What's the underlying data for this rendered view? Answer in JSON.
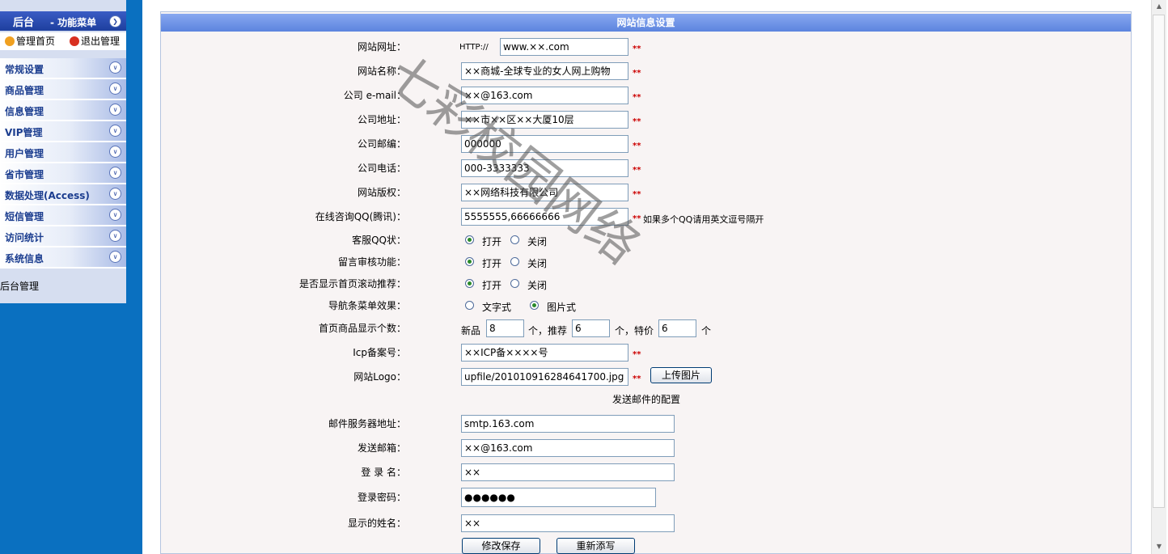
{
  "sidebar": {
    "title": "后台",
    "subtitle": "- 功能菜单",
    "links": [
      {
        "label": "管理首页"
      },
      {
        "label": "退出管理"
      }
    ],
    "items": [
      {
        "label": "常规设置"
      },
      {
        "label": "商品管理"
      },
      {
        "label": "信息管理"
      },
      {
        "label": "VIP管理"
      },
      {
        "label": "用户管理"
      },
      {
        "label": "省市管理"
      },
      {
        "label": "数据处理(Access)"
      },
      {
        "label": "短信管理"
      },
      {
        "label": "访问统计"
      },
      {
        "label": "系统信息"
      }
    ],
    "footer": "后台管理"
  },
  "panel": {
    "title": "网站信息设置",
    "site_url": {
      "label": "网站网址：",
      "prefix": "HTTP://",
      "value": "www.××.com"
    },
    "site_name": {
      "label": "网站名称：",
      "value": "××商城-全球专业的女人网上购物"
    },
    "email": {
      "label": "公司 e-mail：",
      "value": "××@163.com"
    },
    "address": {
      "label": "公司地址：",
      "value": "××市××区××大厦10层"
    },
    "zip": {
      "label": "公司邮编：",
      "value": "000000"
    },
    "phone": {
      "label": "公司电话：",
      "value": "000-3333333"
    },
    "copyright": {
      "label": "网站版权：",
      "value": "××网络科技有限公司"
    },
    "qq": {
      "label": "在线咨询QQ(腾讯)：",
      "value": "5555555,66666666",
      "note": "如果多个QQ请用英文逗号隔开"
    },
    "kefu": {
      "label": "客服QQ状：",
      "opt1": "打开",
      "opt2": "关闭",
      "selected": "打开"
    },
    "audit": {
      "label": "留言审核功能：",
      "opt1": "打开",
      "opt2": "关闭",
      "selected": "打开"
    },
    "scroll": {
      "label": "是否显示首页滚动推荐：",
      "opt1": "打开",
      "opt2": "关闭",
      "selected": "打开"
    },
    "nav": {
      "label": "导航条菜单效果：",
      "opt1": "文字式",
      "opt2": "图片式",
      "selected": "图片式"
    },
    "counts": {
      "label": "首页商品显示个数：",
      "new_label": "新品",
      "new_value": "8",
      "unit1": "个，推荐",
      "rec_value": "6",
      "unit2": "个，特价",
      "sp_value": "6",
      "unit3": "个"
    },
    "icp": {
      "label": "Icp备案号：",
      "value": "××ICP备××××号"
    },
    "logo": {
      "label": "网站Logo：",
      "value": "upfile/201010916284641700.jpg",
      "button": "上传图片"
    },
    "mail_section": "发送邮件的配置",
    "smtp": {
      "label": "邮件服务器地址：",
      "value": "smtp.163.com"
    },
    "sender": {
      "label": "发送邮箱：",
      "value": "××@163.com"
    },
    "login": {
      "label": "登 录 名：",
      "value": "××"
    },
    "password": {
      "label": "登录密码：",
      "value": "●●●●●●"
    },
    "display_name": {
      "label": "显示的姓名：",
      "value": "××"
    },
    "save_button": "修改保存",
    "reset_button": "重新添写",
    "required_mark": "**"
  },
  "watermark": "七彩校园网络"
}
